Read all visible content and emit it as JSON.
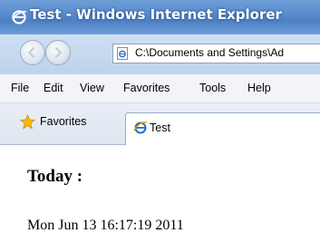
{
  "window": {
    "title": "Test - Windows Internet Explorer",
    "icon": "ie-icon"
  },
  "navigation": {
    "back_icon": "back-arrow-icon",
    "forward_icon": "forward-arrow-icon"
  },
  "address_bar": {
    "value": "C:\\Documents and Settings\\Ad",
    "icon": "page-icon"
  },
  "menu": {
    "items": [
      "File",
      "Edit",
      "View",
      "Favorites",
      "Tools",
      "Help"
    ]
  },
  "favorites_bar": {
    "favorites_label": "Favorites",
    "favorites_icon": "star-icon"
  },
  "tabs": [
    {
      "label": "Test",
      "icon": "ie-icon"
    }
  ],
  "page": {
    "heading": "Today :",
    "datetime": "Mon Jun 13 16:17:19 2011"
  },
  "colors": {
    "titlebar": "#5a8ccf",
    "address_row": "#c6daf0",
    "menubar": "#f2f4f8",
    "favbar": "#e6ebf3"
  }
}
